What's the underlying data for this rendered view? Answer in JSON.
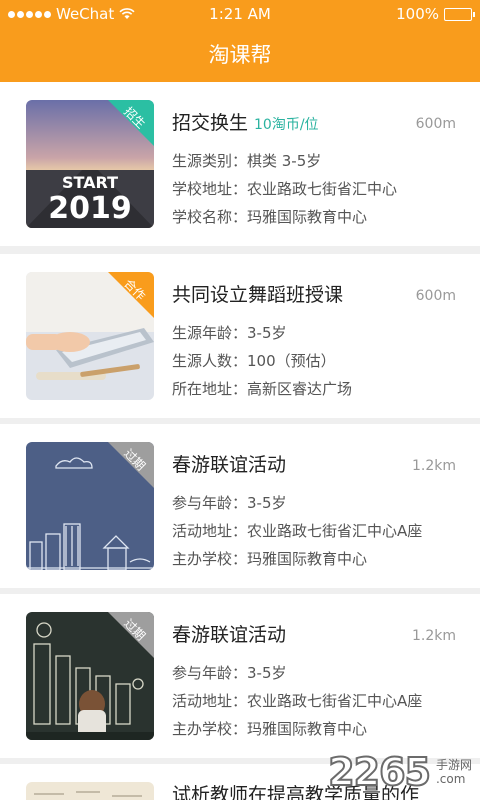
{
  "status_bar": {
    "carrier": "WeChat",
    "time": "1:21 AM",
    "battery": "100%",
    "battery_level": 1.0
  },
  "nav": {
    "title": "淘课帮"
  },
  "items": [
    {
      "title": "招交换生",
      "price": "10淘币/位",
      "distance": "600m",
      "tag": "招生",
      "tag_color": "#2bbfa3",
      "lines": [
        "生源类别：棋类 3-5岁",
        "学校地址：农业路政七街省汇中心",
        "学校名称：玛雅国际教育中心"
      ],
      "image_text": "START 2019"
    },
    {
      "title": "共同设立舞蹈班授课",
      "distance": "600m",
      "tag": "合作",
      "tag_color": "#f99c1c",
      "lines": [
        "生源年龄：3-5岁",
        "生源人数：100（预估）",
        "所在地址：高新区睿达广场"
      ]
    },
    {
      "title": "春游联谊活动",
      "distance": "1.2km",
      "tag": "过期",
      "tag_color": "#9e9e9e",
      "lines": [
        "参与年龄：3-5岁",
        "活动地址：农业路政七街省汇中心A座",
        "主办学校：玛雅国际教育中心"
      ]
    },
    {
      "title": "春游联谊活动",
      "distance": "1.2km",
      "tag": "过期",
      "tag_color": "#9e9e9e",
      "lines": [
        "参与年龄：3-5岁",
        "活动地址：农业路政七街省汇中心A座",
        "主办学校：玛雅国际教育中心"
      ]
    },
    {
      "title": "试析教师在提高教学质量的作"
    }
  ],
  "watermark": {
    "number": "2265",
    "suffix": ".com",
    "label": "手游网"
  },
  "colors": {
    "accent": "#f99c1c",
    "price": "#2bb3a0"
  }
}
